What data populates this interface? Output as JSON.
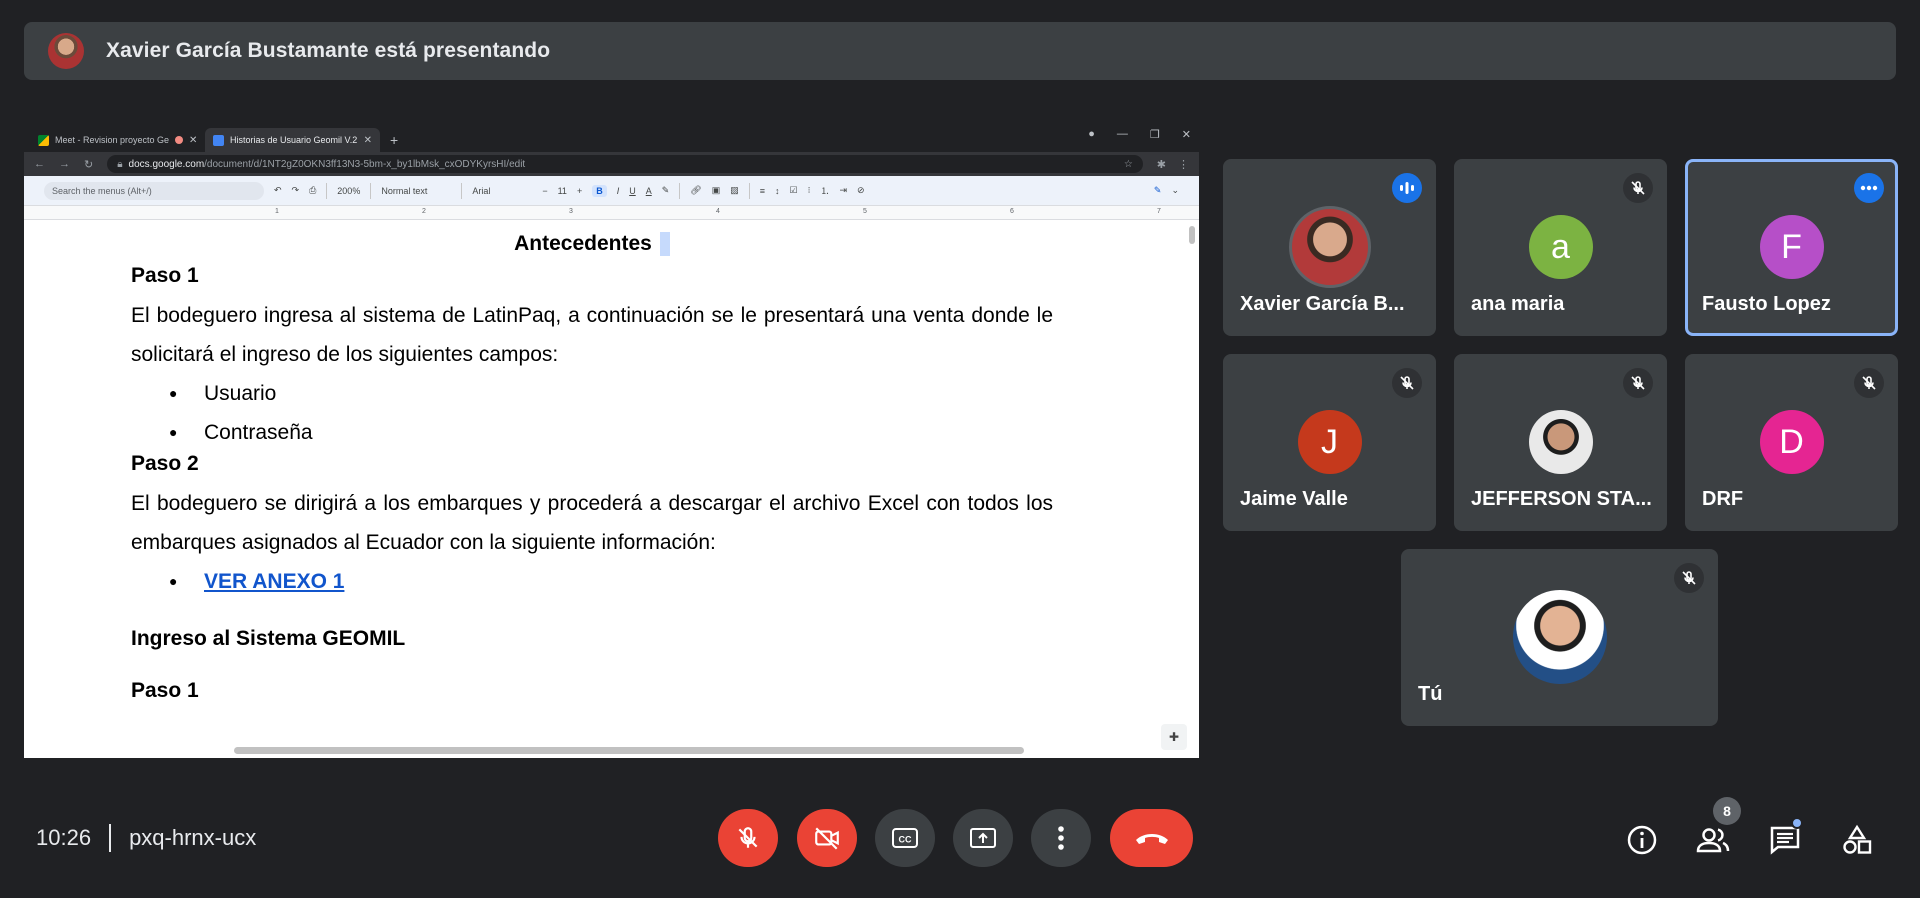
{
  "presenting_banner": {
    "text": "Xavier García Bustamante está presentando"
  },
  "browser": {
    "tabs": [
      {
        "label": "Meet - Revision proyecto Ge"
      },
      {
        "label": "Historias de Usuario Geomil V.2"
      }
    ],
    "url_domain": "docs.google.com",
    "url_path": "/document/d/1NT2gZ0OKN3ff13N3-5bm-x_by1lbMsk_cxODYKyrsHI/edit"
  },
  "docs_toolbar": {
    "search_placeholder": "Search the menus (Alt+/)",
    "zoom": "200%",
    "style": "Normal text",
    "font": "Arial",
    "font_size": "11"
  },
  "ruler_ticks": [
    "1",
    "2",
    "3",
    "4",
    "5",
    "6",
    "7"
  ],
  "document": {
    "title": "Antecedentes",
    "step1_heading": "Paso 1",
    "step1_text": "El bodeguero ingresa al sistema de LatinPaq, a continuación se le presentará una venta donde le solicitará el ingreso de los siguientes campos:",
    "step1_items": [
      "Usuario",
      "Contraseña"
    ],
    "step2_heading": "Paso 2",
    "step2_text": "El bodeguero se dirigirá a los embarques y procederá a descargar el archivo Excel con todos los embarques asignados al Ecuador con la siguiente información:",
    "step2_link": "VER ANEXO 1",
    "section_heading": "Ingreso al Sistema GEOMIL",
    "step3_heading": "Paso 1"
  },
  "participants": [
    {
      "name": "Xavier García B...",
      "initial": "",
      "color": "#5f6368",
      "status": "speaking"
    },
    {
      "name": "ana maria",
      "initial": "a",
      "color": "#7cb342",
      "status": "muted"
    },
    {
      "name": "Fausto Lopez",
      "initial": "F",
      "color": "#b64fc8",
      "status": "more"
    },
    {
      "name": "Jaime Valle",
      "initial": "J",
      "color": "#c5391c",
      "status": "muted"
    },
    {
      "name": "JEFFERSON STA...",
      "initial": "",
      "color": "#5f6368",
      "status": "muted"
    },
    {
      "name": "DRF",
      "initial": "D",
      "color": "#e52592",
      "status": "muted"
    },
    {
      "name": "Tú",
      "initial": "",
      "color": "#5f6368",
      "status": "muted"
    }
  ],
  "meeting": {
    "time": "10:26",
    "code": "pxq-hrnx-ucx",
    "people_count": "8"
  },
  "colors": {
    "end_call": "#ea4335",
    "muted_control": "#ea4335",
    "control_gray": "#3c4043",
    "speaking_border": "#8ab4f8"
  }
}
